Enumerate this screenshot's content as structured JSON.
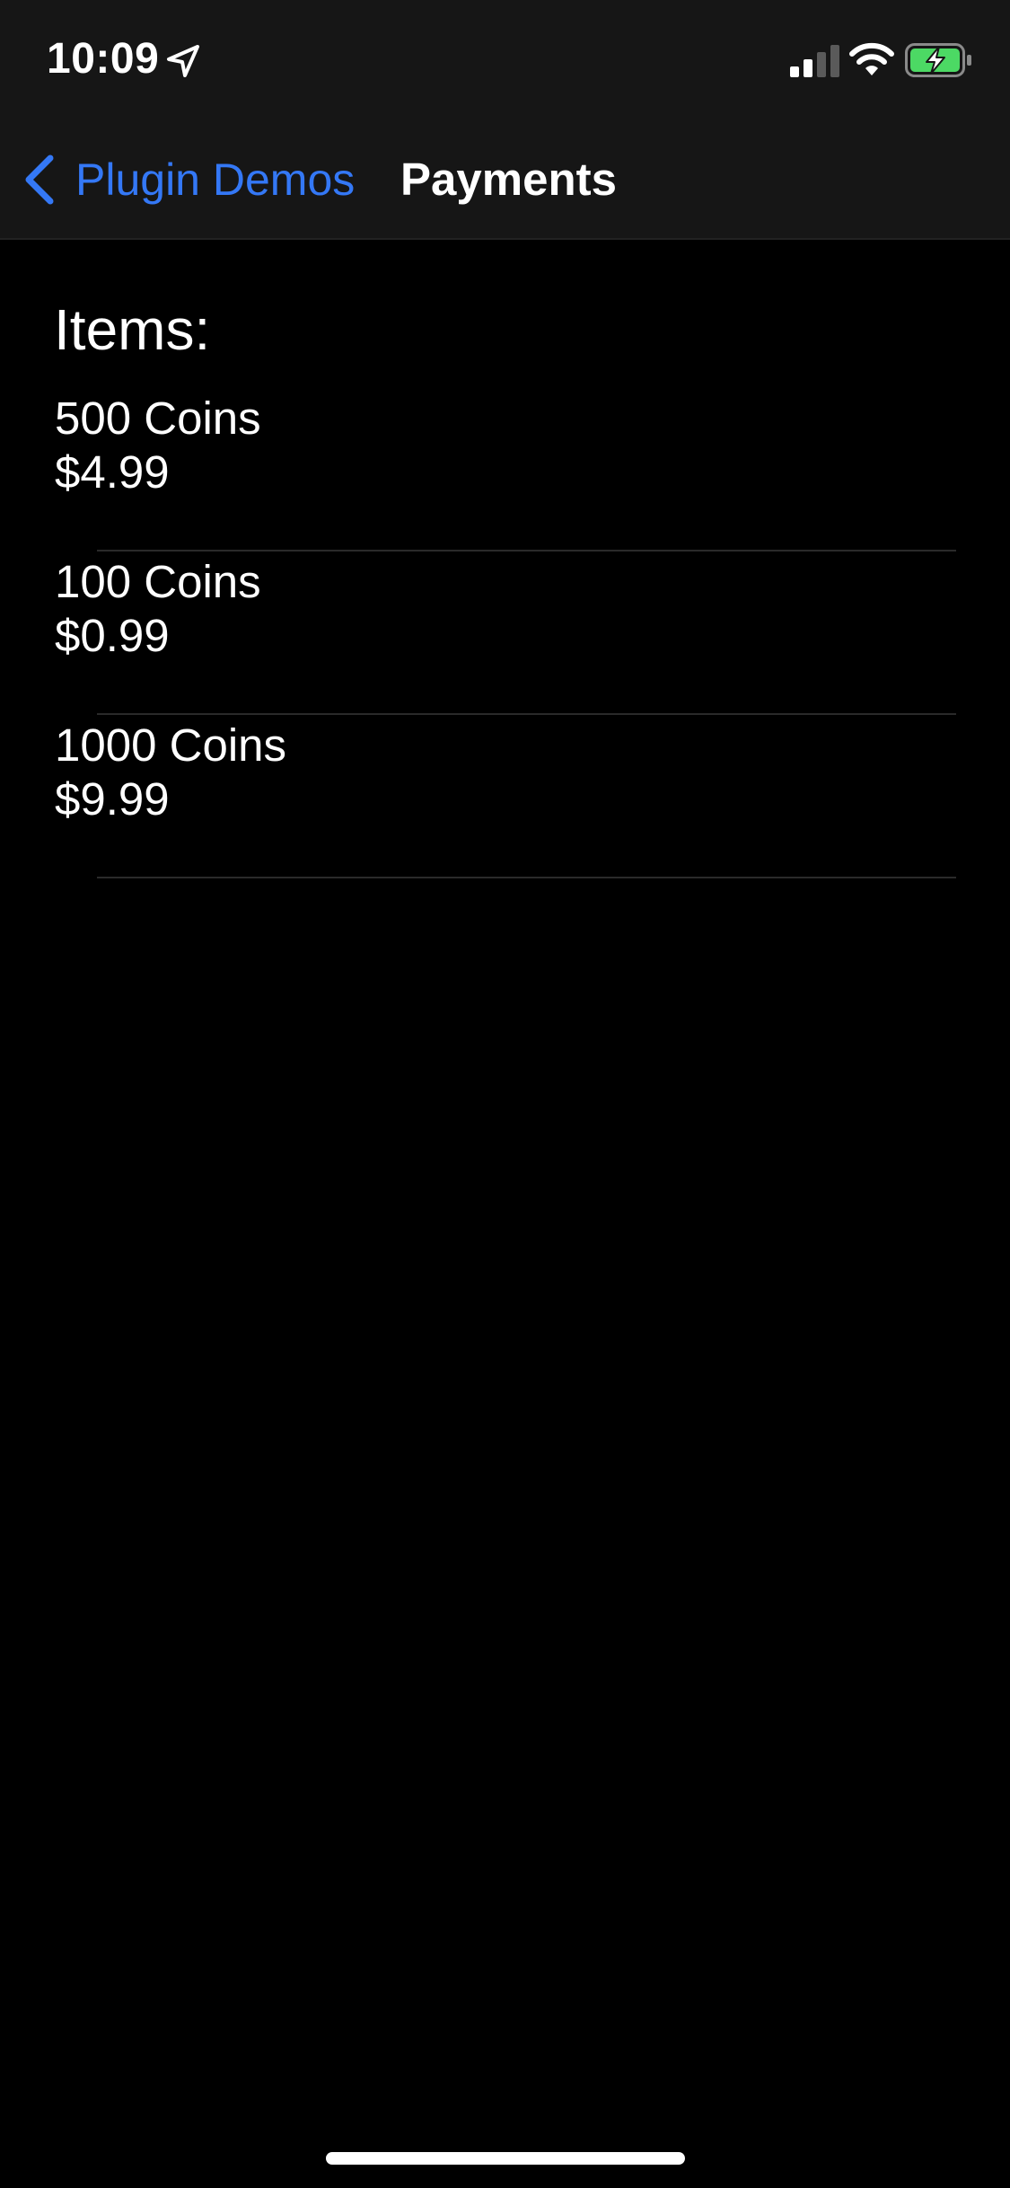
{
  "status_bar": {
    "time": "10:09",
    "icons": [
      "location-arrow-icon",
      "cellular-signal-icon",
      "wifi-icon",
      "battery-charging-icon"
    ],
    "battery_color": "#4cd964"
  },
  "nav_bar": {
    "back_label": "Plugin Demos",
    "title": "Payments",
    "accent_color": "#3478f6"
  },
  "content": {
    "heading": "Items:",
    "items": [
      {
        "name": "500 Coins",
        "price": "$4.99"
      },
      {
        "name": "100 Coins",
        "price": "$0.99"
      },
      {
        "name": "1000 Coins",
        "price": "$9.99"
      }
    ]
  }
}
